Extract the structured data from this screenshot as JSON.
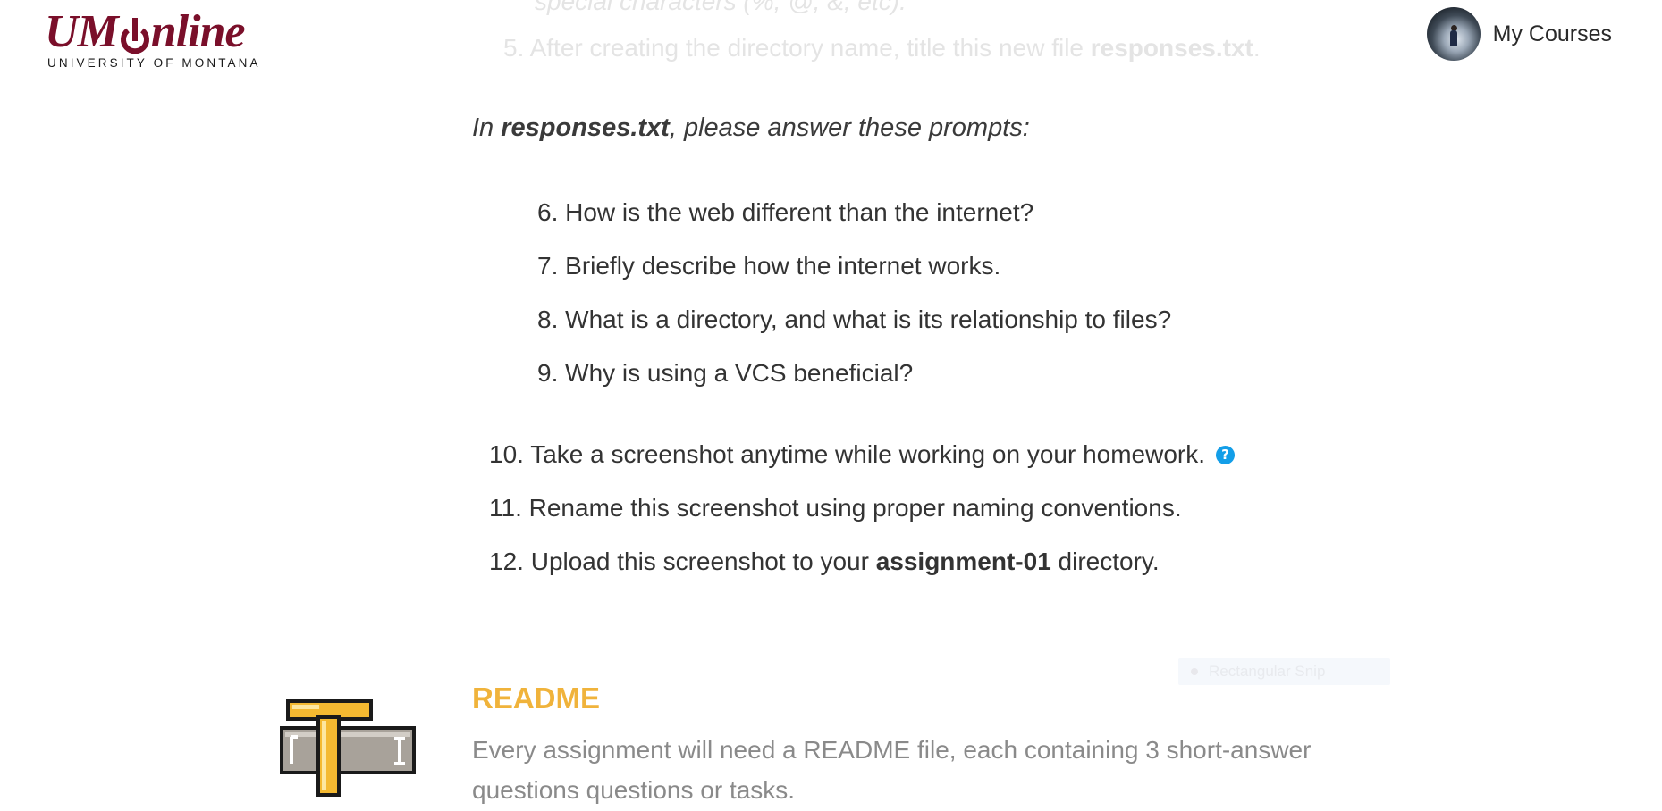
{
  "header": {
    "logo": {
      "main_left": "UM",
      "main_right": "nline",
      "sub": "UNIVERSITY OF MONTANA"
    },
    "user_menu": {
      "label": "My Courses"
    }
  },
  "faded_steps": [
    {
      "text": "special characters (%, @, &, etc)."
    },
    {
      "number": "5.",
      "text_before": "After creating the directory name, title this new file ",
      "bold": "responses.txt",
      "text_after": "."
    }
  ],
  "prompts_intro": {
    "before": "In ",
    "bold": "responses.txt",
    "after": ", please answer these prompts:"
  },
  "prompts": [
    {
      "number": "6.",
      "text": "How is the web different than the internet?"
    },
    {
      "number": "7.",
      "text": "Briefly describe how the internet works."
    },
    {
      "number": "8.",
      "text": "What is a directory, and what is its relationship to files?"
    },
    {
      "number": "9.",
      "text": "Why is using a VCS beneficial?"
    }
  ],
  "tasks": [
    {
      "number": "10.",
      "text": "Take a screenshot anytime while working on your homework.",
      "help_icon": "?"
    },
    {
      "number": "11.",
      "text": "Rename this screenshot using proper naming conventions."
    },
    {
      "number": "12.",
      "text_before": "Upload this screenshot to your ",
      "bold": "assignment-01",
      "text_after": " directory."
    }
  ],
  "overlay": {
    "snip_label": "Rectangular Snip"
  },
  "readme": {
    "icon": "text-tool-icon",
    "title": "README",
    "description": "Every assignment will need a README file, each containing 3 short-answer questions questions or tasks."
  },
  "colors": {
    "brand": "#7a0f2a",
    "readme_accent": "#f0b33b",
    "help_icon": "#139ee8"
  }
}
